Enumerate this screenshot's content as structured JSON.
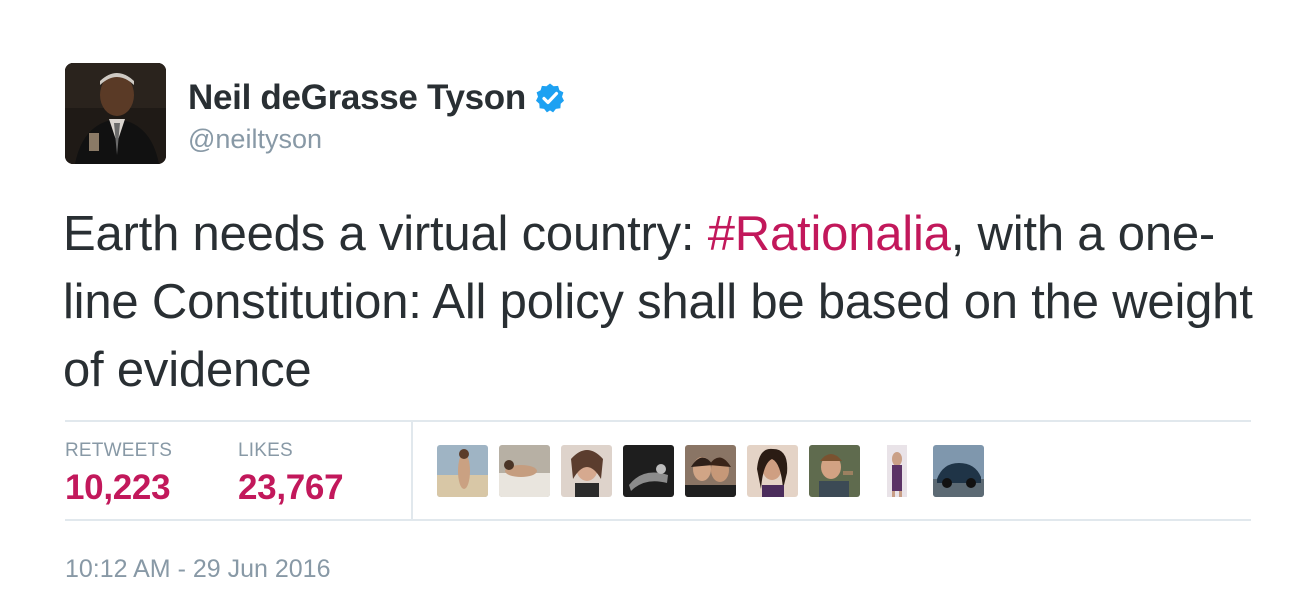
{
  "author": {
    "display_name": "Neil deGrasse Tyson",
    "handle": "@neiltyson",
    "verified_icon": "verified-badge-icon",
    "avatar": "profile-photo"
  },
  "tweet": {
    "text_before": "Earth needs a virtual country: ",
    "hashtag": "#Rationalia",
    "text_after": ", with a one-line Constitution: All policy shall be based on the weight of evidence"
  },
  "stats": {
    "retweets_label": "RETWEETS",
    "retweets_count": "10,223",
    "likes_label": "LIKES",
    "likes_count": "23,767"
  },
  "likers_count_shown": 9,
  "timestamp": "10:12 AM - 29 Jun 2016",
  "colors": {
    "accent": "#c2185b",
    "verified": "#1da1f2",
    "muted": "#8899a6",
    "text": "#292f33",
    "divider": "#e1e8ed"
  }
}
